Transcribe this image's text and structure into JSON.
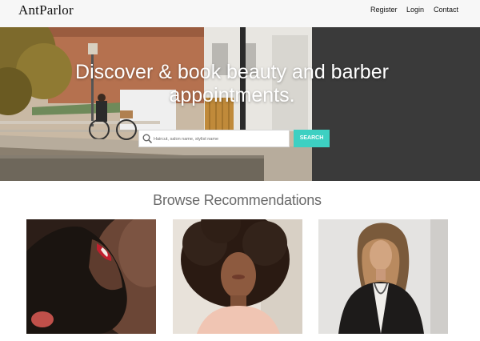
{
  "header": {
    "brand": "AntParlor",
    "nav": {
      "register": "Register",
      "login": "Login",
      "contact": "Contact"
    }
  },
  "hero": {
    "title": "Discover & book beauty and barber appointments.",
    "search": {
      "placeholder": "Haircut, salon name, stylist name",
      "value": ""
    },
    "search_button": "SEARCH"
  },
  "browse": {
    "title": "Browse Recommendations"
  },
  "colors": {
    "accent": "#3dd0c2",
    "hero_dark": "#3a3a3a",
    "header_bg": "#f7f7f7"
  }
}
